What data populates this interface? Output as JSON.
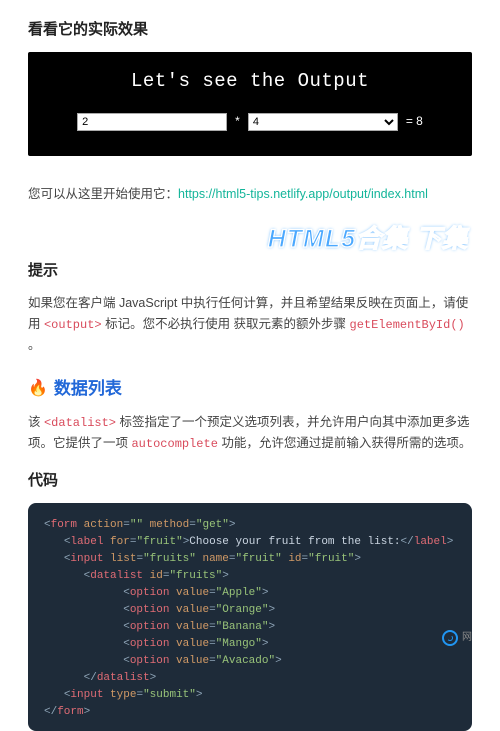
{
  "section1": {
    "heading": "看看它的实际效果",
    "demoTitle": "Let's see the Output",
    "inputA": "2",
    "star": "*",
    "selectB": "4",
    "resultPrefix": "= ",
    "result": "8"
  },
  "usage": {
    "leadin": "您可以从这里开始使用它：",
    "url": "https://html5-tips.netlify.app/output/index.html"
  },
  "watermark": "HTML5合集 下集",
  "tips": {
    "heading": "提示",
    "t1": "如果您在客户端 JavaScript 中执行任何计算，并且希望结果反映在页面上，请使用 ",
    "code1": "<output>",
    "t2": " 标记。您不必执行使用 获取元素的额外步骤 ",
    "code2": "getElementById()",
    "t3": " 。"
  },
  "datalist": {
    "heading": "数据列表",
    "t1": "该 ",
    "code1": "<datalist>",
    "t2": " 标签指定了一个预定义选项列表，并允许用户向其中添加更多选项。它提供了一项 ",
    "code2": "autocomplete",
    "t3": " 功能，允许您通过提前输入获得所需的选项。"
  },
  "codeSection": {
    "heading": "代码",
    "lines": [
      {
        "indent": 0,
        "tokens": [
          {
            "c": "t-punc",
            "v": "<"
          },
          {
            "c": "t-tag",
            "v": "form"
          },
          {
            "c": "t-text",
            "v": " "
          },
          {
            "c": "t-attr",
            "v": "action"
          },
          {
            "c": "t-punc",
            "v": "="
          },
          {
            "c": "t-str",
            "v": "\"\""
          },
          {
            "c": "t-text",
            "v": " "
          },
          {
            "c": "t-attr",
            "v": "method"
          },
          {
            "c": "t-punc",
            "v": "="
          },
          {
            "c": "t-str",
            "v": "\"get\""
          },
          {
            "c": "t-punc",
            "v": ">"
          }
        ]
      },
      {
        "indent": 1,
        "tokens": [
          {
            "c": "t-punc",
            "v": "<"
          },
          {
            "c": "t-tag",
            "v": "label"
          },
          {
            "c": "t-text",
            "v": " "
          },
          {
            "c": "t-attr",
            "v": "for"
          },
          {
            "c": "t-punc",
            "v": "="
          },
          {
            "c": "t-str",
            "v": "\"fruit\""
          },
          {
            "c": "t-punc",
            "v": ">"
          },
          {
            "c": "t-text",
            "v": "Choose your fruit from the list:"
          },
          {
            "c": "t-punc",
            "v": "</"
          },
          {
            "c": "t-tag",
            "v": "label"
          },
          {
            "c": "t-punc",
            "v": ">"
          }
        ]
      },
      {
        "indent": 1,
        "tokens": [
          {
            "c": "t-punc",
            "v": "<"
          },
          {
            "c": "t-tag",
            "v": "input"
          },
          {
            "c": "t-text",
            "v": " "
          },
          {
            "c": "t-attr",
            "v": "list"
          },
          {
            "c": "t-punc",
            "v": "="
          },
          {
            "c": "t-str",
            "v": "\"fruits\""
          },
          {
            "c": "t-text",
            "v": " "
          },
          {
            "c": "t-attr",
            "v": "name"
          },
          {
            "c": "t-punc",
            "v": "="
          },
          {
            "c": "t-str",
            "v": "\"fruit\""
          },
          {
            "c": "t-text",
            "v": " "
          },
          {
            "c": "t-attr",
            "v": "id"
          },
          {
            "c": "t-punc",
            "v": "="
          },
          {
            "c": "t-str",
            "v": "\"fruit\""
          },
          {
            "c": "t-punc",
            "v": ">"
          }
        ]
      },
      {
        "indent": 2,
        "tokens": [
          {
            "c": "t-punc",
            "v": "<"
          },
          {
            "c": "t-tag",
            "v": "datalist"
          },
          {
            "c": "t-text",
            "v": " "
          },
          {
            "c": "t-attr",
            "v": "id"
          },
          {
            "c": "t-punc",
            "v": "="
          },
          {
            "c": "t-str",
            "v": "\"fruits\""
          },
          {
            "c": "t-punc",
            "v": ">"
          }
        ]
      },
      {
        "indent": 4,
        "tokens": [
          {
            "c": "t-punc",
            "v": "<"
          },
          {
            "c": "t-tag",
            "v": "option"
          },
          {
            "c": "t-text",
            "v": " "
          },
          {
            "c": "t-attr",
            "v": "value"
          },
          {
            "c": "t-punc",
            "v": "="
          },
          {
            "c": "t-str",
            "v": "\"Apple\""
          },
          {
            "c": "t-punc",
            "v": ">"
          }
        ]
      },
      {
        "indent": 4,
        "tokens": [
          {
            "c": "t-punc",
            "v": "<"
          },
          {
            "c": "t-tag",
            "v": "option"
          },
          {
            "c": "t-text",
            "v": " "
          },
          {
            "c": "t-attr",
            "v": "value"
          },
          {
            "c": "t-punc",
            "v": "="
          },
          {
            "c": "t-str",
            "v": "\"Orange\""
          },
          {
            "c": "t-punc",
            "v": ">"
          }
        ]
      },
      {
        "indent": 4,
        "tokens": [
          {
            "c": "t-punc",
            "v": "<"
          },
          {
            "c": "t-tag",
            "v": "option"
          },
          {
            "c": "t-text",
            "v": " "
          },
          {
            "c": "t-attr",
            "v": "value"
          },
          {
            "c": "t-punc",
            "v": "="
          },
          {
            "c": "t-str",
            "v": "\"Banana\""
          },
          {
            "c": "t-punc",
            "v": ">"
          }
        ]
      },
      {
        "indent": 4,
        "tokens": [
          {
            "c": "t-punc",
            "v": "<"
          },
          {
            "c": "t-tag",
            "v": "option"
          },
          {
            "c": "t-text",
            "v": " "
          },
          {
            "c": "t-attr",
            "v": "value"
          },
          {
            "c": "t-punc",
            "v": "="
          },
          {
            "c": "t-str",
            "v": "\"Mango\""
          },
          {
            "c": "t-punc",
            "v": ">"
          }
        ]
      },
      {
        "indent": 4,
        "tokens": [
          {
            "c": "t-punc",
            "v": "<"
          },
          {
            "c": "t-tag",
            "v": "option"
          },
          {
            "c": "t-text",
            "v": " "
          },
          {
            "c": "t-attr",
            "v": "value"
          },
          {
            "c": "t-punc",
            "v": "="
          },
          {
            "c": "t-str",
            "v": "\"Avacado\""
          },
          {
            "c": "t-punc",
            "v": ">"
          }
        ]
      },
      {
        "indent": 2,
        "tokens": [
          {
            "c": "t-punc",
            "v": "</"
          },
          {
            "c": "t-tag",
            "v": "datalist"
          },
          {
            "c": "t-punc",
            "v": ">"
          }
        ]
      },
      {
        "indent": 1,
        "tokens": [
          {
            "c": "t-punc",
            "v": "<"
          },
          {
            "c": "t-tag",
            "v": "input"
          },
          {
            "c": "t-text",
            "v": " "
          },
          {
            "c": "t-attr",
            "v": "type"
          },
          {
            "c": "t-punc",
            "v": "="
          },
          {
            "c": "t-str",
            "v": "\"submit\""
          },
          {
            "c": "t-punc",
            "v": ">"
          }
        ]
      },
      {
        "indent": 0,
        "tokens": [
          {
            "c": "t-punc",
            "v": "</"
          },
          {
            "c": "t-tag",
            "v": "form"
          },
          {
            "c": "t-punc",
            "v": ">"
          }
        ]
      }
    ]
  },
  "footer": {
    "text": "网"
  }
}
